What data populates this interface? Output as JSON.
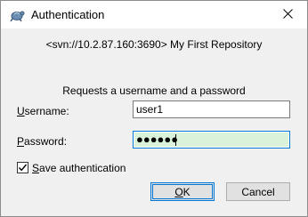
{
  "window": {
    "title": "Authentication",
    "icons": {
      "app": "tortoise-svn-icon",
      "close": "close-icon"
    }
  },
  "dialog": {
    "repository": "<svn://10.2.87.160:3690> My First Repository",
    "prompt": "Requests a username and a password",
    "username": {
      "label_accel": "U",
      "label_rest": "sername:",
      "value": "user1"
    },
    "password": {
      "label_accel": "P",
      "label_rest": "assword:",
      "masked_value": "●●●●●●",
      "highlight_color": "#d9f2d9"
    },
    "save_auth": {
      "label_accel": "S",
      "label_rest": "ave authentication",
      "checked": true
    },
    "buttons": {
      "ok_accel": "O",
      "ok_rest": "K",
      "cancel": "Cancel"
    },
    "accent_color": "#0078d7"
  }
}
